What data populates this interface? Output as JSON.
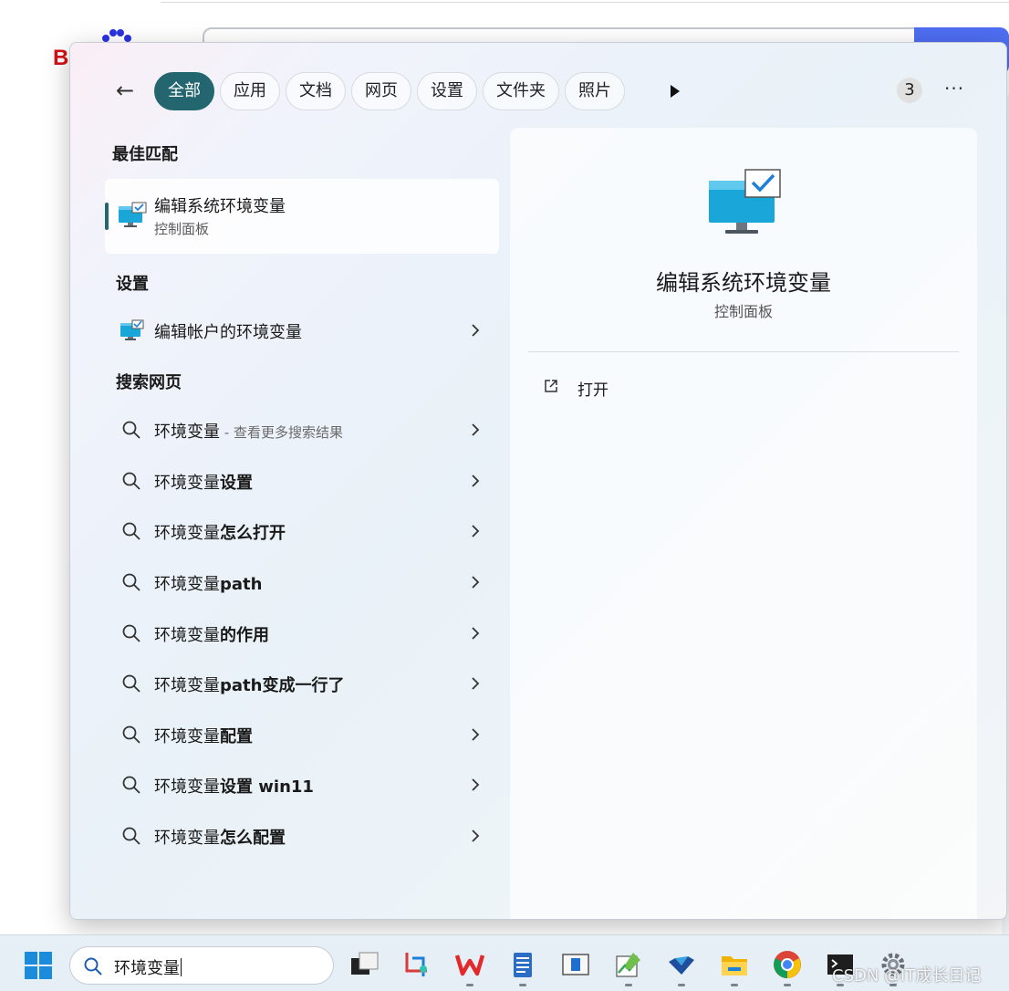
{
  "background": {
    "logo_letter": "B"
  },
  "filters": {
    "back_label": "←",
    "items": [
      "全部",
      "应用",
      "文档",
      "网页",
      "设置",
      "文件夹",
      "照片"
    ],
    "result_count": "3",
    "more_label": "···"
  },
  "best_match": {
    "section_title": "最佳匹配",
    "title": "编辑系统环境变量",
    "subtitle": "控制面板"
  },
  "settings": {
    "section_title": "设置",
    "items": [
      "编辑帐户的环境变量"
    ]
  },
  "web": {
    "section_title": "搜索网页",
    "first": {
      "query": "环境变量",
      "hint": " - 查看更多搜索结果"
    },
    "suggestions": [
      {
        "prefix": "环境变量",
        "bold": "设置"
      },
      {
        "prefix": "环境变量",
        "bold": "怎么打开"
      },
      {
        "prefix": "环境变量",
        "bold": "path"
      },
      {
        "prefix": "环境变量",
        "bold": "的作用"
      },
      {
        "prefix": "环境变量",
        "bold": "path变成一行了"
      },
      {
        "prefix": "环境变量",
        "bold": "配置"
      },
      {
        "prefix": "环境变量",
        "bold": "设置 win11"
      },
      {
        "prefix": "环境变量",
        "bold": "怎么配置"
      }
    ]
  },
  "preview": {
    "title": "编辑系统环境变量",
    "subtitle": "控制面板",
    "open_label": "打开"
  },
  "taskbar": {
    "search_text": "环境变量",
    "apps": [
      "task-view",
      "snipping-tool",
      "wps",
      "notepad",
      "app-window",
      "image-editor",
      "vscode-like",
      "file-explorer",
      "chrome",
      "terminal",
      "settings"
    ]
  },
  "watermark": "CSDN @IT成长日记",
  "colors": {
    "accent": "#23666f",
    "panel_bg": "#eef4f8",
    "taskbar_bg": "#e6eef6"
  }
}
